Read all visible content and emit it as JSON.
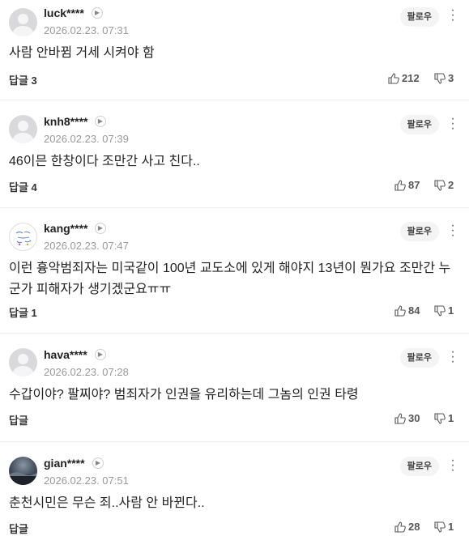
{
  "labels": {
    "follow": "팔로우",
    "reply": "답글"
  },
  "comments": [
    {
      "nick": "luck****",
      "date": "2026.02.23. 07:31",
      "body": "사람 안바뀜 거세 시켜야 함",
      "reply_count": "3",
      "likes": "212",
      "dislikes": "3",
      "avatar": "default-avatar"
    },
    {
      "nick": "knh8****",
      "date": "2026.02.23. 07:39",
      "body": "46이믄 한창이다 조만간 사고 친다..",
      "reply_count": "4",
      "likes": "87",
      "dislikes": "2",
      "avatar": "default-avatar"
    },
    {
      "nick": "kang****",
      "date": "2026.02.23. 07:47",
      "body": "이런 흉악범죄자는 미국같이 100년 교도소에 있게 해야지 13년이 뭔가요 조만간 누군가 피해자가 생기겠군요ㅠㅠ",
      "reply_count": "1",
      "likes": "84",
      "dislikes": "1",
      "avatar": "drawing-avatar"
    },
    {
      "nick": "hava****",
      "date": "2026.02.23. 07:28",
      "body": "수갑이야? 팔찌야? 범죄자가 인권을 유리하는데 그놈의 인권 타령",
      "reply_count": "",
      "likes": "30",
      "dislikes": "1",
      "avatar": "default-avatar"
    },
    {
      "nick": "gian****",
      "date": "2026.02.23. 07:51",
      "body": "춘천시민은 무슨 죄..사람 안 바뀐다..",
      "reply_count": "",
      "likes": "28",
      "dislikes": "1",
      "avatar": "photo-avatar"
    }
  ]
}
